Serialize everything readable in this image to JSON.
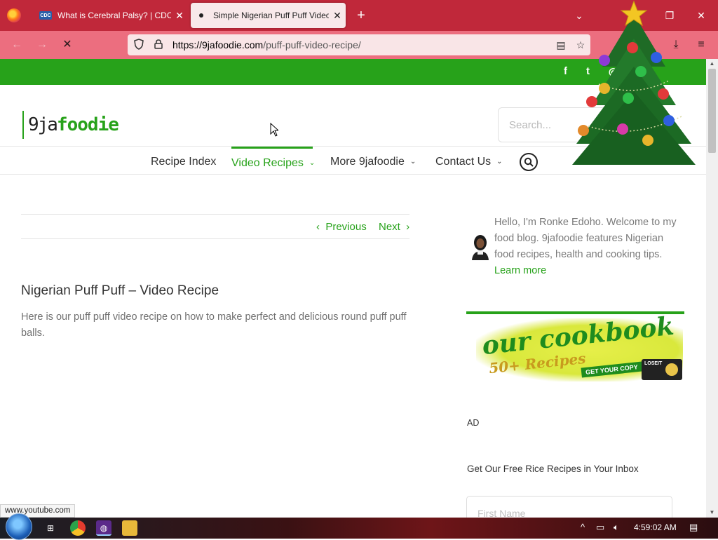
{
  "browser": {
    "tabs": [
      {
        "favicon": "CDC",
        "title": "What is Cerebral Palsy? | CDC"
      },
      {
        "title": "Simple Nigerian Puff Puff Video"
      }
    ],
    "new_tab_icon": "+",
    "list_all_tabs_icon": "⌄",
    "url_domain": "https://9jafoodie.com",
    "url_path": "/puff-puff-video-recipe/"
  },
  "site": {
    "logo_part1": "9ja",
    "logo_part2": "foodie",
    "search_placeholder": "Search...",
    "nav": [
      {
        "label": "Recipe Index"
      },
      {
        "label": "Video Recipes"
      },
      {
        "label": "More 9jafoodie"
      },
      {
        "label": "Contact Us"
      }
    ],
    "social_icons": [
      "facebook-icon",
      "twitter-icon",
      "instagram-icon"
    ]
  },
  "post": {
    "prev": "Previous",
    "next": "Next",
    "title": "Nigerian Puff Puff – Video Recipe",
    "intro": "Here is our puff puff video recipe on how to make perfect and delicious round puff puff balls."
  },
  "sidebar": {
    "bio": "Hello, I'm Ronke Edoho. Welcome to my food blog. 9jafoodie features Nigerian food recipes, health and cooking tips.",
    "learn_more": "Learn more",
    "cookbook_line1": "our cookbook",
    "cookbook_line2": "50+ Recipes",
    "cookbook_cta": "GET YOUR COPY",
    "cookbook_badge": "LOSEIT",
    "ad_label": "AD",
    "rice_heading": "Get Our Free Rice Recipes in Your Inbox",
    "first_name_placeholder": "First Name"
  },
  "status_bar_url": "www.youtube.com",
  "taskbar": {
    "clock": "4:59:02 AM"
  },
  "colors": {
    "brand_green": "#27a21a",
    "tab_bar": "#c0283a",
    "nav_bar": "#ec6e7f"
  }
}
